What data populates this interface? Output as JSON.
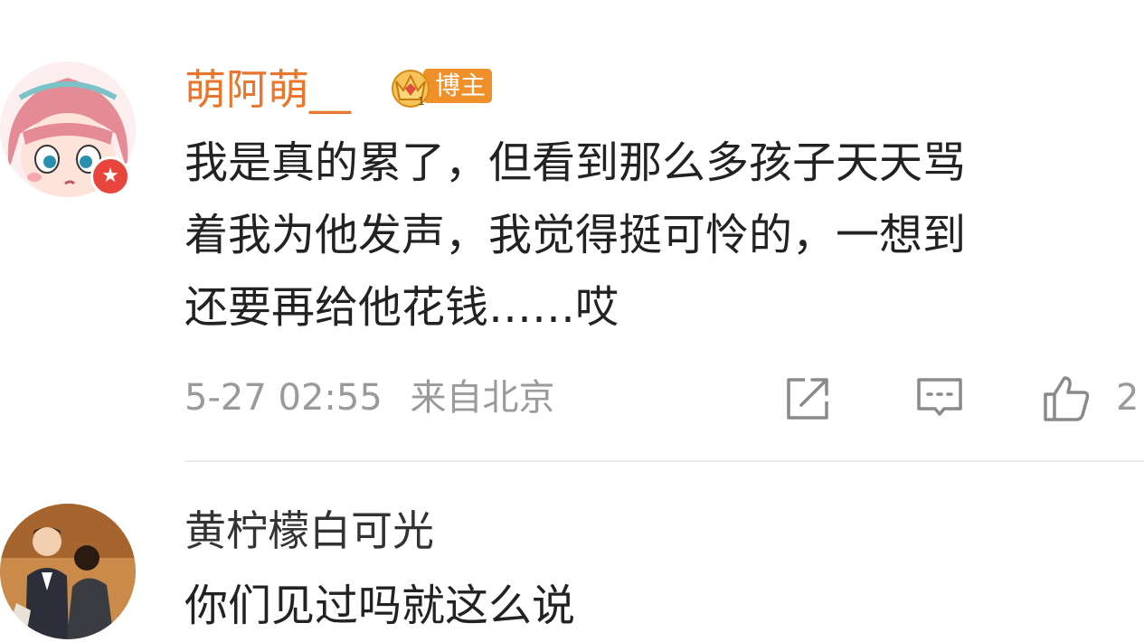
{
  "comments": [
    {
      "username": "萌阿萌__",
      "badge_label": "博主",
      "body_lines": [
        "我是真的累了，但看到那么多孩子天天骂",
        "着我为他发声，我觉得挺可怜的，一想到",
        "还要再给他花钱……哎"
      ],
      "timestamp": "5-27 02:55",
      "location": "来自北京",
      "like_count": "2",
      "icons": {
        "repost": "repost-icon",
        "reply": "comment-icon",
        "like": "thumbs-up-icon"
      }
    },
    {
      "username": "黄柠檬白可光",
      "body_lines": [
        "你们见过吗就这么说"
      ]
    }
  ],
  "colors": {
    "username_highlight": "#e8762d",
    "badge": "#f0902a",
    "text": "#222222",
    "meta": "#9a9a9a",
    "verified": "#e8463c"
  }
}
